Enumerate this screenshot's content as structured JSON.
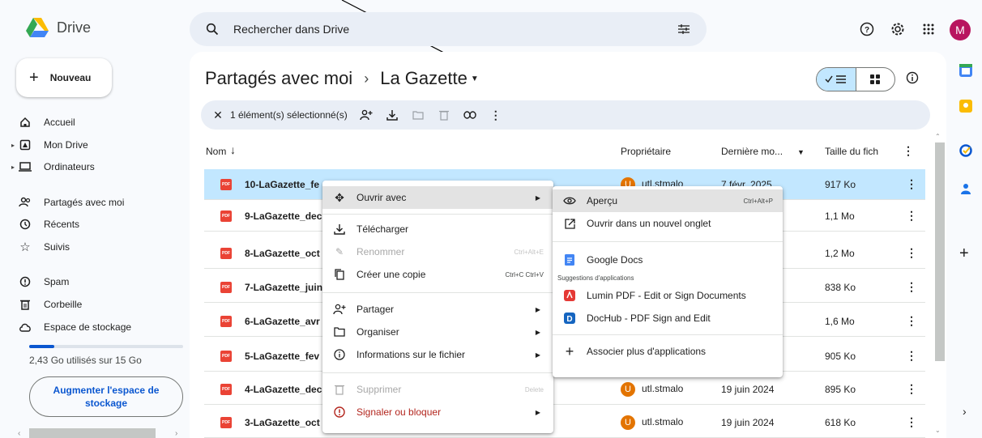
{
  "app": {
    "name": "Drive",
    "avatar_letter": "M",
    "brand_colors": {
      "yellow": "#fbbc04",
      "green": "#34a853",
      "blue": "#4285f4"
    }
  },
  "search": {
    "placeholder": "Rechercher dans Drive"
  },
  "sidebar": {
    "new_label": "Nouveau",
    "items": [
      {
        "label": "Accueil",
        "icon": "home-icon",
        "expandable": false
      },
      {
        "label": "Mon Drive",
        "icon": "drive-icon",
        "expandable": true
      },
      {
        "label": "Ordinateurs",
        "icon": "computer-icon",
        "expandable": true
      },
      {
        "label": "Partagés avec moi",
        "icon": "shared-icon",
        "expandable": false
      },
      {
        "label": "Récents",
        "icon": "clock-icon",
        "expandable": false
      },
      {
        "label": "Suivis",
        "icon": "star-icon",
        "expandable": false
      },
      {
        "label": "Spam",
        "icon": "spam-icon",
        "expandable": false
      },
      {
        "label": "Corbeille",
        "icon": "trash-icon",
        "expandable": false
      },
      {
        "label": "Espace de stockage",
        "icon": "cloud-icon",
        "expandable": false
      }
    ],
    "storage_text": "2,43 Go utilisés sur 15 Go",
    "storage_fraction": 0.162,
    "upgrade_label": "Augmenter l'espace de stockage"
  },
  "breadcrumb": {
    "parent": "Partagés avec moi",
    "separator": "›",
    "current": "La Gazette"
  },
  "selection_bar": {
    "label": "1 élément(s) sélectionné(s)"
  },
  "table": {
    "headers": {
      "name": "Nom",
      "owner": "Propriétaire",
      "modified": "Dernière mo...",
      "size": "Taille du fich"
    },
    "rows": [
      {
        "name": "10-LaGazette_fe",
        "owner": "utl.stmalo",
        "date": "7 févr. 2025",
        "size": "917 Ko",
        "selected": true
      },
      {
        "name": "9-LaGazette_dec",
        "owner": "",
        "date": "",
        "size": "1,1 Mo",
        "selected": false
      },
      {
        "name": "8-LaGazette_oct",
        "owner": "",
        "date": "",
        "size": "1,2 Mo",
        "selected": false
      },
      {
        "name": "7-LaGazette_juin",
        "owner": "",
        "date": "",
        "size": "838 Ko",
        "selected": false
      },
      {
        "name": "6-LaGazette_avr",
        "owner": "",
        "date": "",
        "size": "1,6 Mo",
        "selected": false
      },
      {
        "name": "5-LaGazette_fev",
        "owner": "",
        "date": "",
        "size": "905 Ko",
        "selected": false
      },
      {
        "name": "4-LaGazette_dec",
        "owner": "utl.stmalo",
        "date": "19 juin 2024",
        "size": "895 Ko",
        "selected": false
      },
      {
        "name": "3-LaGazette_oct",
        "owner": "utl.stmalo",
        "date": "19 juin 2024",
        "size": "618 Ko",
        "selected": false
      }
    ]
  },
  "context_menu": {
    "open_with": "Ouvrir avec",
    "download": "Télécharger",
    "rename": "Renommer",
    "rename_shortcut": "Ctrl+Alt+E",
    "copy": "Créer une copie",
    "copy_shortcut": "Ctrl+C Ctrl+V",
    "share": "Partager",
    "organize": "Organiser",
    "info": "Informations sur le fichier",
    "delete": "Supprimer",
    "delete_shortcut": "Delete",
    "report": "Signaler ou bloquer"
  },
  "submenu": {
    "preview": "Aperçu",
    "preview_shortcut": "Ctrl+Alt+P",
    "new_tab": "Ouvrir dans un nouvel onglet",
    "google_docs": "Google Docs",
    "suggestions_header": "Suggestions d'applications",
    "lumin": "Lumin PDF - Edit or Sign Documents",
    "dochub": "DocHub - PDF Sign and Edit",
    "more_apps": "Associer plus d'applications"
  }
}
